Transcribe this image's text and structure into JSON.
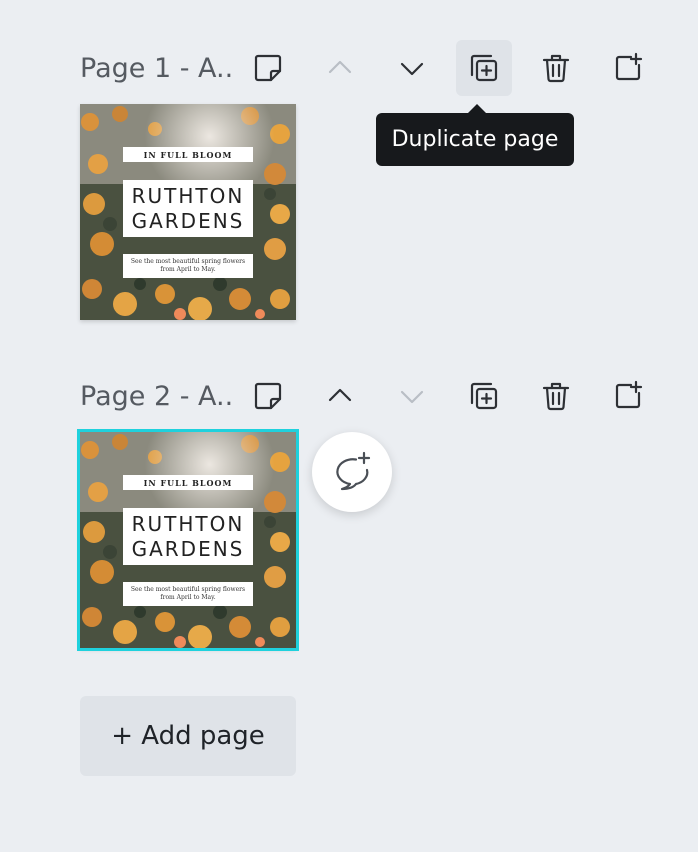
{
  "pages": [
    {
      "title": "Page 1 - A..",
      "thumbnail": {
        "label": "IN FULL BLOOM",
        "title_line1": "RUTHTON",
        "title_line2": "GARDENS",
        "text_line1": "See the most beautiful spring flowers",
        "text_line2": "from April to May."
      },
      "move_up_enabled": false,
      "move_down_enabled": true,
      "selected": false
    },
    {
      "title": "Page 2 - A..",
      "thumbnail": {
        "label": "IN FULL BLOOM",
        "title_line1": "RUTHTON",
        "title_line2": "GARDENS",
        "text_line1": "See the most beautiful spring flowers",
        "text_line2": "from April to May."
      },
      "move_up_enabled": true,
      "move_down_enabled": false,
      "selected": true
    }
  ],
  "tooltip": {
    "text": "Duplicate page"
  },
  "add_page": {
    "label": "+ Add page"
  },
  "icons": {
    "notes": "sticky-note-icon",
    "up": "chevron-up-icon",
    "down": "chevron-down-icon",
    "duplicate": "duplicate-page-icon",
    "delete": "trash-icon",
    "add": "add-page-icon",
    "comment": "add-comment-icon"
  },
  "colors": {
    "background": "#ebeef2",
    "selection": "#1fd1dd",
    "tooltip_bg": "#17191c"
  }
}
